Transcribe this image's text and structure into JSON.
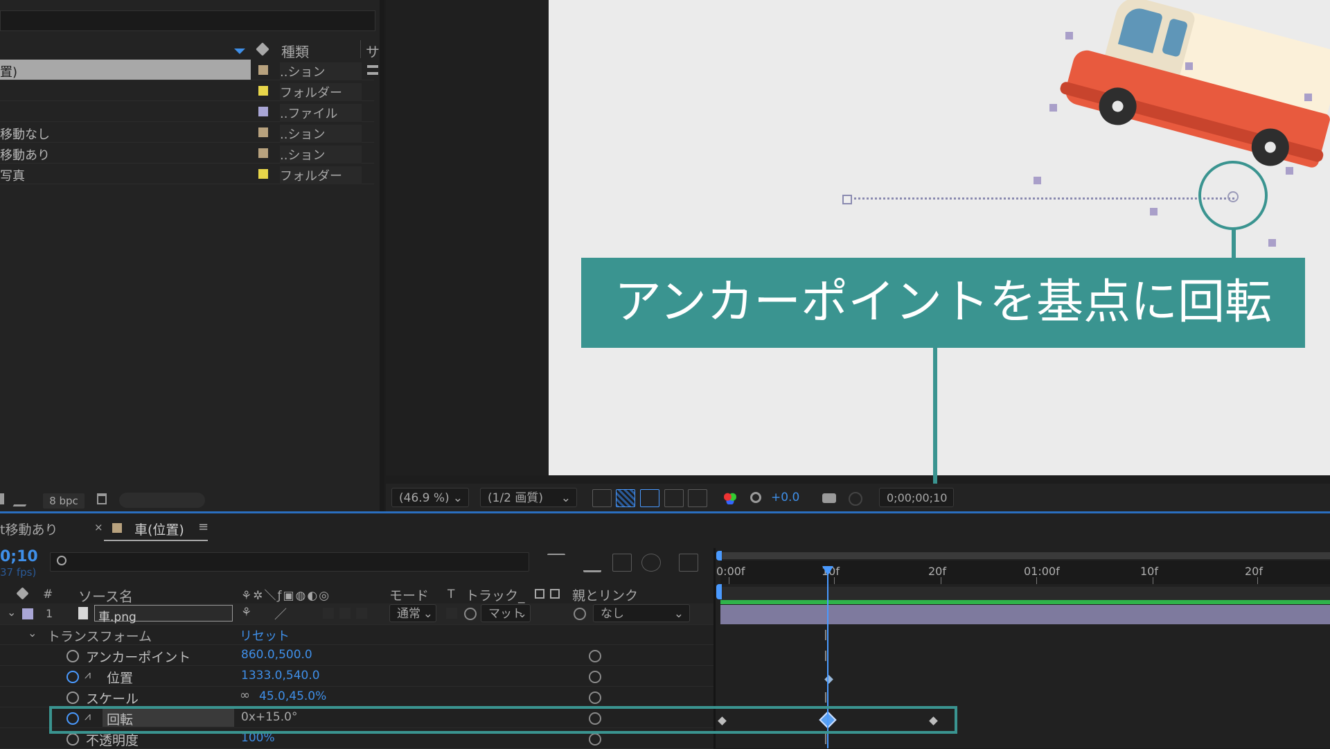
{
  "project": {
    "col_type": "種類",
    "col_size": "サ-",
    "items": [
      {
        "name": "置)",
        "type": "..ション",
        "color": "#b8a27e",
        "selected": true
      },
      {
        "name": "",
        "type": "フォルダー",
        "color": "#e8d64a"
      },
      {
        "name": "",
        "type": "..ファイル",
        "color": "#a9a6d6"
      },
      {
        "name": "移動なし",
        "type": "..ション",
        "color": "#b8a27e"
      },
      {
        "name": "移動あり",
        "type": "..ション",
        "color": "#b8a27e"
      },
      {
        "name": "写真",
        "type": "フォルダー",
        "color": "#e8d64a"
      }
    ],
    "bpc": "8 bpc"
  },
  "viewer": {
    "zoom": "(46.9 %)",
    "resolution": "(1/2 画質)",
    "exposure": "+0.0",
    "timecode": "0;00;00;10"
  },
  "annotation": {
    "label": "アンカーポイントを基点に回転",
    "color": "#3a9490"
  },
  "timeline": {
    "tab_prev": "t移動あり",
    "tab_active": "車(位置)",
    "current_time": "0;10",
    "fps": "37 fps)",
    "headers": {
      "num": "#",
      "source": "ソース名",
      "mode": "モード",
      "t": "T",
      "track": "トラック_",
      "parent": "親とリンク"
    },
    "layer": {
      "index": "1",
      "name": "車.png",
      "mode": "通常",
      "matte": "マット",
      "parent": "なし"
    },
    "transform_label": "トランスフォーム",
    "reset": "リセット",
    "props": [
      {
        "name": "アンカーポイント",
        "value": "860.0,500.0"
      },
      {
        "name": "位置",
        "value": "1333.0,540.0"
      },
      {
        "name": "スケール",
        "value": "45.0,45.0%"
      },
      {
        "name": "回転",
        "value": "0x+15.0°"
      },
      {
        "name": "不透明度",
        "value": "100%"
      }
    ],
    "ruler": [
      "0:00f",
      "10f",
      "20f",
      "01:00f",
      "10f",
      "20f"
    ]
  }
}
